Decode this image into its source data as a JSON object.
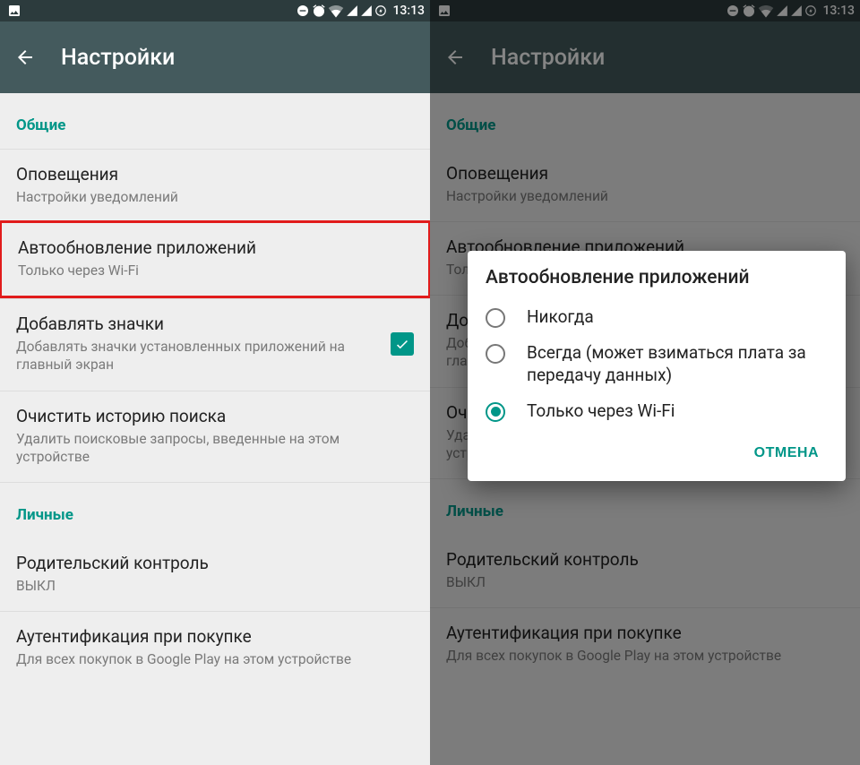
{
  "status": {
    "time": "13:13"
  },
  "appbar": {
    "title": "Настройки"
  },
  "sections": {
    "general": {
      "label": "Общие",
      "notifications": {
        "title": "Оповещения",
        "sub": "Настройки уведомлений"
      },
      "autoupdate": {
        "title": "Автообновление приложений",
        "sub": "Только через Wi-Fi"
      },
      "icons": {
        "title": "Добавлять значки",
        "sub": "Добавлять значки установленных приложений на главный экран"
      },
      "clearhist": {
        "title": "Очистить историю поиска",
        "sub": "Удалить поисковые запросы, введенные на этом устройстве"
      }
    },
    "personal": {
      "label": "Личные",
      "parental": {
        "title": "Родительский контроль",
        "sub": "ВЫКЛ"
      },
      "auth": {
        "title": "Аутентификация при покупке",
        "sub": "Для всех покупок в Google Play на этом устройстве"
      }
    }
  },
  "dialog": {
    "title": "Автообновление приложений",
    "opt_never": "Никогда",
    "opt_always": "Всегда (может взиматься плата за передачу данных)",
    "opt_wifi": "Только через Wi-Fi",
    "cancel": "ОТМЕНА"
  }
}
